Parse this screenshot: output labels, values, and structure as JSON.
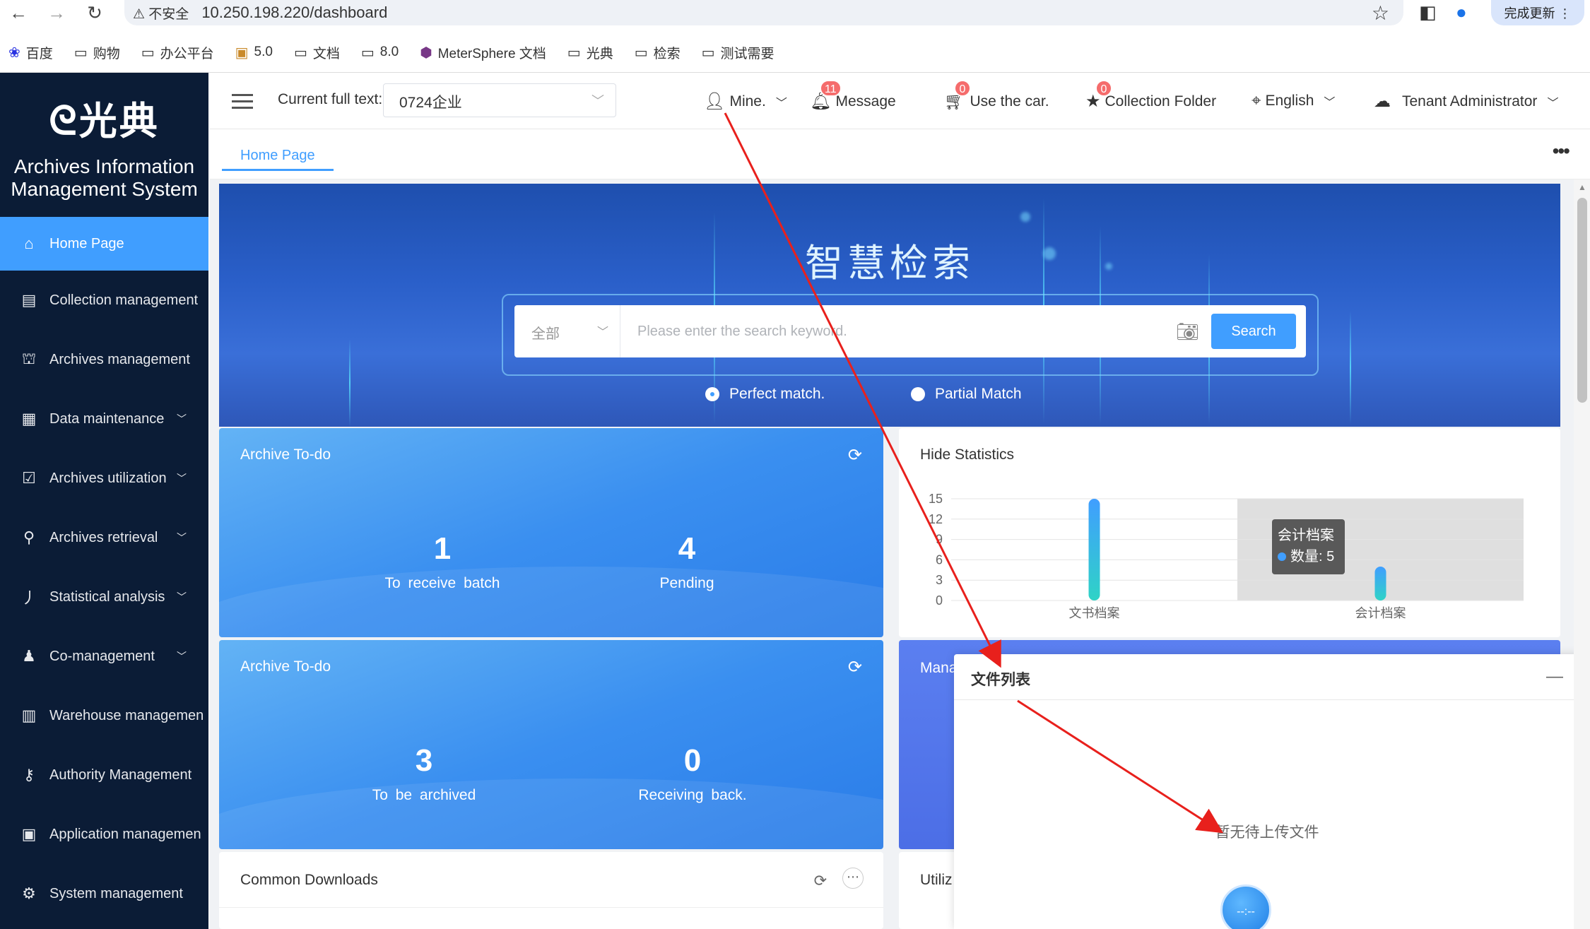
{
  "browser": {
    "security_label": "⚠ 不安全",
    "url": "10.250.198.220/dashboard",
    "update_label": "完成更新 ⋮",
    "bookmarks": [
      {
        "icon": "baidu-icon",
        "label": "百度"
      },
      {
        "icon": "folder-icon",
        "label": "购物"
      },
      {
        "icon": "folder-icon",
        "label": "办公平台"
      },
      {
        "icon": "image-icon",
        "label": "5.0"
      },
      {
        "icon": "folder-icon",
        "label": "文档"
      },
      {
        "icon": "folder-icon",
        "label": "8.0"
      },
      {
        "icon": "metersphere-icon",
        "label": "MeterSphere 文档"
      },
      {
        "icon": "folder-icon",
        "label": "光典"
      },
      {
        "icon": "folder-icon",
        "label": "检索"
      },
      {
        "icon": "folder-icon",
        "label": "测试需要"
      }
    ]
  },
  "sidebar": {
    "logo_text": "光典",
    "title_line1": "Archives Information",
    "title_line2": "Management System",
    "items": [
      {
        "label": "Home Page",
        "icon": "home-icon",
        "active": true
      },
      {
        "label": "Collection management",
        "icon": "collection-icon"
      },
      {
        "label": "Archives management",
        "icon": "bank-icon"
      },
      {
        "label": "Data maintenance",
        "icon": "data-icon",
        "caret": true
      },
      {
        "label": "Archives utilization",
        "icon": "clipboard-icon",
        "caret": true
      },
      {
        "label": "Archives retrieval",
        "icon": "search-icon",
        "caret": true
      },
      {
        "label": "Statistical analysis",
        "icon": "chart-icon",
        "caret": true
      },
      {
        "label": "Co-management",
        "icon": "user-icon",
        "caret": true
      },
      {
        "label": "Warehouse managemen",
        "icon": "building-icon"
      },
      {
        "label": "Authority Management",
        "icon": "key-icon"
      },
      {
        "label": "Application managemen",
        "icon": "app-icon"
      },
      {
        "label": "System management",
        "icon": "gear-icon"
      }
    ]
  },
  "header": {
    "current_label": "Current full text:",
    "current_value": "0724企业",
    "mine": "Mine.",
    "message": "Message",
    "message_badge": "11",
    "car": "Use the car.",
    "car_badge": "0",
    "collection": "Collection Folder",
    "collection_badge": "0",
    "language": "English",
    "role": "Tenant Administrator"
  },
  "tabs": {
    "home": "Home Page"
  },
  "banner": {
    "title": "智慧检索",
    "scope": "全部",
    "placeholder": "Please enter the search keyword.",
    "search_button": "Search",
    "radio_exact": "Perfect match.",
    "radio_partial": "Partial Match"
  },
  "todo1": {
    "title": "Archive To-do",
    "stat1_value": "1",
    "stat1_label": "To receive batch",
    "stat2_value": "4",
    "stat2_label": "Pending"
  },
  "todo2": {
    "title": "Archive To-do",
    "stat1_value": "3",
    "stat1_label": "To be archived",
    "stat2_value": "0",
    "stat2_label": "Receiving back."
  },
  "stats": {
    "title": "Hide Statistics",
    "tooltip_name": "会计档案",
    "tooltip_value": "数量: 5"
  },
  "chart_data": {
    "type": "bar",
    "categories": [
      "文书档案",
      "会计档案"
    ],
    "values": [
      15,
      5
    ],
    "yticks": [
      "15",
      "12",
      "9",
      "6",
      "3",
      "0"
    ],
    "ylim": [
      0,
      15
    ],
    "bar_gradient": [
      "#409eff",
      "#2fd3c6"
    ]
  },
  "manage_card": {
    "title": "Mana"
  },
  "file_panel": {
    "title": "文件列表",
    "minimize": "—",
    "empty_text": "暂无待上传文件",
    "fab_text": "--:--"
  },
  "downloads": {
    "title": "Common Downloads"
  },
  "utiliz": {
    "title": "Utiliz"
  }
}
